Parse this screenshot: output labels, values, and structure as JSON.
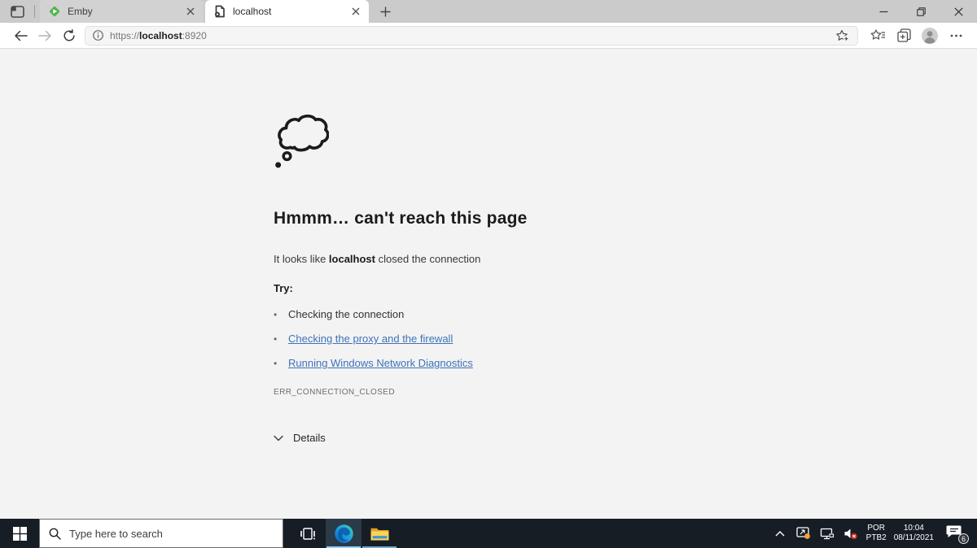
{
  "browser": {
    "tabs": [
      {
        "label": "Emby"
      },
      {
        "label": "localhost"
      }
    ],
    "address": {
      "scheme": "https://",
      "host": "localhost",
      "port": ":8920"
    }
  },
  "error_page": {
    "title": "Hmmm… can't reach this page",
    "message_prefix": "It looks like ",
    "message_host": "localhost",
    "message_suffix": " closed the connection",
    "try_label": "Try:",
    "bullet": "•",
    "suggestions": [
      {
        "label": "Checking the connection"
      },
      {
        "label": "Checking the proxy and the firewall"
      },
      {
        "label": "Running Windows Network Diagnostics"
      }
    ],
    "error_code": "ERR_CONNECTION_CLOSED",
    "details_label": "Details"
  },
  "taskbar": {
    "search_placeholder": "Type here to search",
    "tray": {
      "language_line1": "POR",
      "language_line2": "PTB2",
      "time": "10:04",
      "date": "08/11/2021",
      "notification_count": "6"
    }
  },
  "icons": {
    "tab_actions": "window-pane outline",
    "emby_logo": "green diamond with white play triangle",
    "page_document": "dark page with circle (no favicon)",
    "close": "x",
    "new_tab": "+",
    "back": "left arrow",
    "forward": "right arrow (disabled)",
    "refresh": "circular arrow",
    "info": "i in circle",
    "add_favorite": "star with plus",
    "favorites": "star with lines",
    "collections": "stacked squares with plus",
    "profile": "person avatar circle",
    "more": "ellipsis",
    "thought_cloud": "outlined thought bubble",
    "chevron_down": "v chevron",
    "windows_start": "four pane windows logo",
    "search_magnifier": "magnifying glass",
    "task_view": "task view strip",
    "edge_logo": "blue-green swirl",
    "file_explorer": "yellow folder",
    "tray_chevron_up": "caret up",
    "tray_alert": "device icon with orange dot",
    "tray_network": "monitor network icon",
    "tray_volume_muted": "speaker with red x",
    "notification_bubble": "comment bubble with count"
  },
  "colors": {
    "link_blue": "#3e72b7",
    "taskbar_bg": "#171d25",
    "active_underline": "#8fd0f8",
    "emby_green": "#52b54b",
    "folder_yellow": "#ffd157",
    "alert_orange": "#f2a33a",
    "mute_red": "#c42b1c"
  }
}
